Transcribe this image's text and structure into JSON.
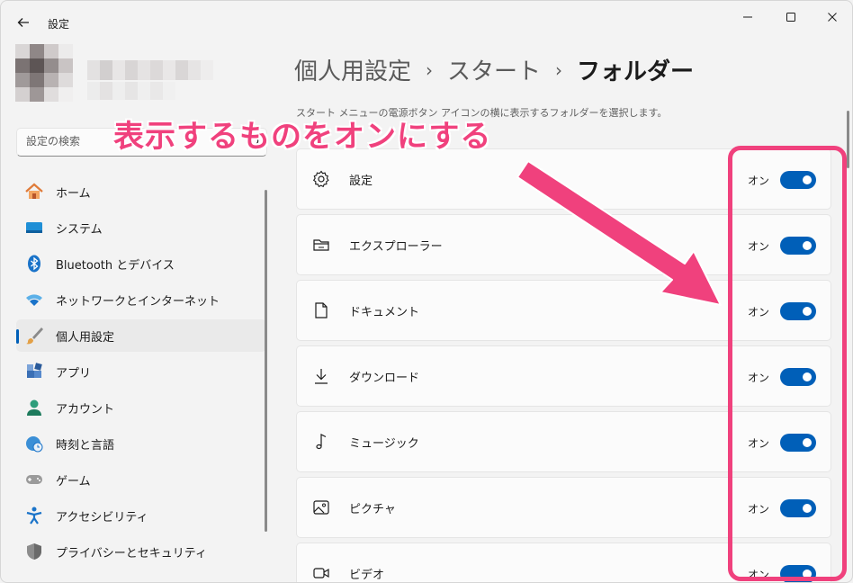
{
  "window": {
    "title": "設定"
  },
  "search": {
    "placeholder": "設定の検索"
  },
  "nav": {
    "items": [
      {
        "label": "ホーム"
      },
      {
        "label": "システム"
      },
      {
        "label": "Bluetooth とデバイス"
      },
      {
        "label": "ネットワークとインターネット"
      },
      {
        "label": "個人用設定"
      },
      {
        "label": "アプリ"
      },
      {
        "label": "アカウント"
      },
      {
        "label": "時刻と言語"
      },
      {
        "label": "ゲーム"
      },
      {
        "label": "アクセシビリティ"
      },
      {
        "label": "プライバシーとセキュリティ"
      }
    ],
    "active_index": 4
  },
  "breadcrumb": {
    "level1": "個人用設定",
    "level2": "スタート",
    "current": "フォルダー"
  },
  "description": "スタート メニューの電源ボタン アイコンの横に表示するフォルダーを選択します。",
  "folders": [
    {
      "label": "設定",
      "state": "オン",
      "icon": "gear-icon",
      "on": true
    },
    {
      "label": "エクスプローラー",
      "state": "オン",
      "icon": "folder-icon",
      "on": true
    },
    {
      "label": "ドキュメント",
      "state": "オン",
      "icon": "document-icon",
      "on": true
    },
    {
      "label": "ダウンロード",
      "state": "オン",
      "icon": "download-icon",
      "on": true
    },
    {
      "label": "ミュージック",
      "state": "オン",
      "icon": "music-note-icon",
      "on": true
    },
    {
      "label": "ピクチャ",
      "state": "オン",
      "icon": "picture-icon",
      "on": true
    },
    {
      "label": "ビデオ",
      "state": "オン",
      "icon": "video-icon",
      "on": true
    }
  ],
  "annotation": {
    "text": "表示するものをオンにする"
  },
  "colors": {
    "accent": "#005fb8",
    "annotation": "#f0417d",
    "background": "#f3f3f3"
  }
}
